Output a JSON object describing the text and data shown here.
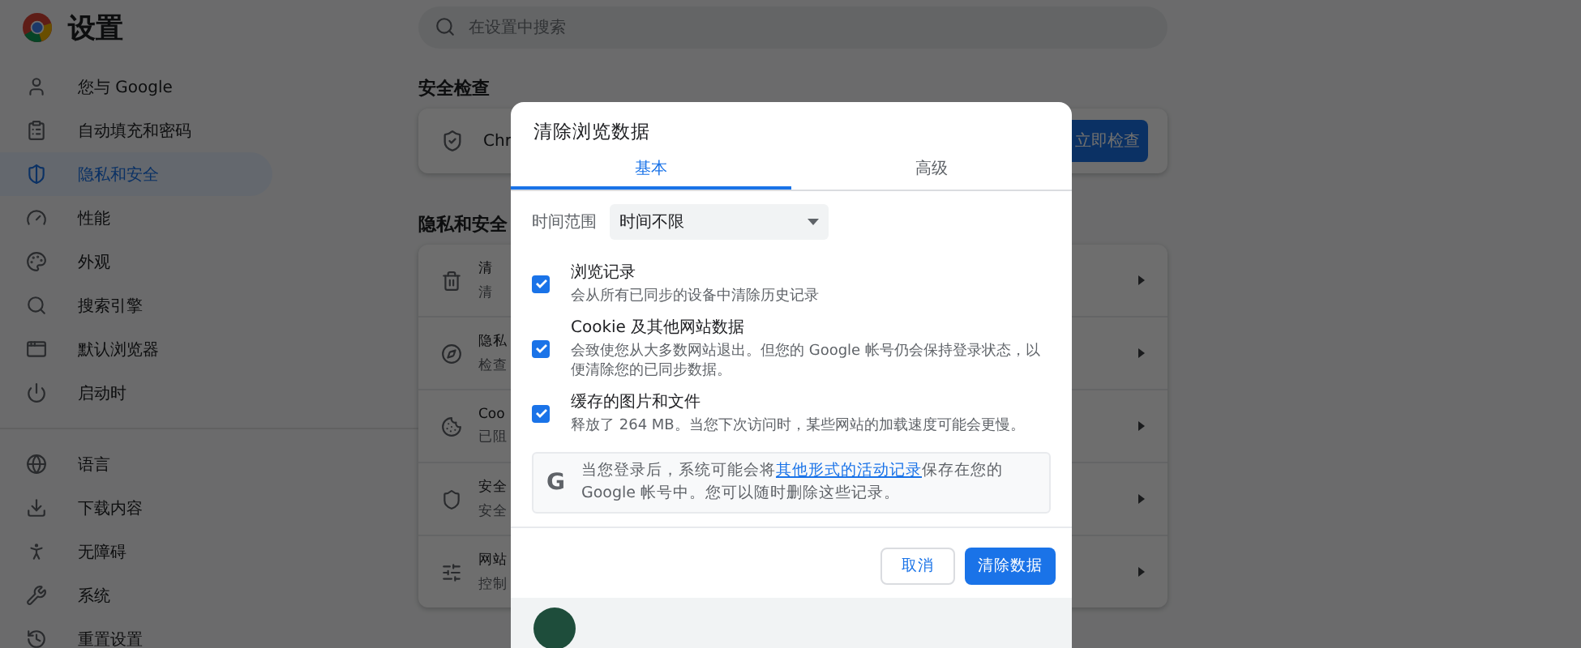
{
  "app": {
    "title": "设置"
  },
  "search": {
    "placeholder": "在设置中搜索"
  },
  "sidebar": {
    "groups": [
      [
        {
          "label": "您与 Google",
          "selected": false
        },
        {
          "label": "自动填充和密码",
          "selected": false
        },
        {
          "label": "隐私和安全",
          "selected": true
        },
        {
          "label": "性能",
          "selected": false
        },
        {
          "label": "外观",
          "selected": false
        },
        {
          "label": "搜索引擎",
          "selected": false
        },
        {
          "label": "默认浏览器",
          "selected": false
        },
        {
          "label": "启动时",
          "selected": false
        }
      ],
      [
        {
          "label": "语言",
          "selected": false
        },
        {
          "label": "下载内容",
          "selected": false
        },
        {
          "label": "无障碍",
          "selected": false
        },
        {
          "label": "系统",
          "selected": false
        },
        {
          "label": "重置设置",
          "selected": false
        }
      ]
    ]
  },
  "safety_check": {
    "heading": "安全检查",
    "card_text": "Chr",
    "button": "立即检查"
  },
  "privacy": {
    "heading": "隐私和安全",
    "rows": [
      {
        "title": "清",
        "subtitle": "清"
      },
      {
        "title": "隐私",
        "subtitle": "检查"
      },
      {
        "title": "Coo",
        "subtitle": "已阻"
      },
      {
        "title": "安全",
        "subtitle": "安全"
      },
      {
        "title": "网站",
        "subtitle": "控制"
      }
    ]
  },
  "dialog": {
    "title": "清除浏览数据",
    "tabs": [
      {
        "label": "基本",
        "selected": true
      },
      {
        "label": "高级",
        "selected": false
      }
    ],
    "time_range": {
      "label": "时间范围",
      "value": "时间不限"
    },
    "options": [
      {
        "title": "浏览记录",
        "description": "会从所有已同步的设备中清除历史记录",
        "checked": true
      },
      {
        "title": "Cookie 及其他网站数据",
        "description": "会致使您从大多数网站退出。但您的 Google 帐号仍会保持登录状态，以便清除您的已同步数据。",
        "checked": true
      },
      {
        "title": "缓存的图片和文件",
        "description": "释放了 264 MB。当您下次访问时，某些网站的加载速度可能会更慢。",
        "checked": true
      }
    ],
    "info": {
      "badge": "G",
      "before": "当您登录后，系统可能会将",
      "link": "其他形式的活动记录",
      "after": "保存在您的 Google 帐号中。您可以随时删除这些记录。"
    },
    "buttons": [
      {
        "label": "取消",
        "kind": "secondary"
      },
      {
        "label": "清除数据",
        "kind": "primary"
      }
    ]
  }
}
